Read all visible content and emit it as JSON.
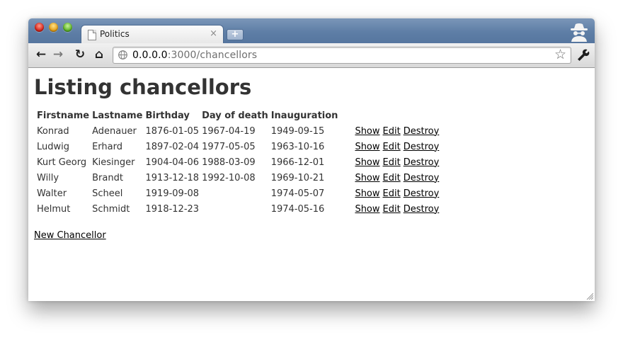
{
  "window": {
    "tab_title": "Politics",
    "tab_close": "×",
    "new_tab": "+"
  },
  "toolbar": {
    "back": "←",
    "forward": "→",
    "reload": "↻",
    "home": "⌂",
    "url_host": "0.0.0.0",
    "url_rest": ":3000/chancellors",
    "star": "☆"
  },
  "page": {
    "title": "Listing chancellors",
    "columns": [
      "Firstname",
      "Lastname",
      "Birthday",
      "Day of death",
      "Inauguration"
    ],
    "rows": [
      [
        "Konrad",
        "Adenauer",
        "1876-01-05",
        "1967-04-19",
        "1949-09-15"
      ],
      [
        "Ludwig",
        "Erhard",
        "1897-02-04",
        "1977-05-05",
        "1963-10-16"
      ],
      [
        "Kurt Georg",
        "Kiesinger",
        "1904-04-06",
        "1988-03-09",
        "1966-12-01"
      ],
      [
        "Willy",
        "Brandt",
        "1913-12-18",
        "1992-10-08",
        "1969-10-21"
      ],
      [
        "Walter",
        "Scheel",
        "1919-09-08",
        "",
        "1974-05-07"
      ],
      [
        "Helmut",
        "Schmidt",
        "1918-12-23",
        "",
        "1974-05-16"
      ]
    ],
    "actions": [
      "Show",
      "Edit",
      "Destroy"
    ],
    "new_link": "New Chancellor"
  }
}
